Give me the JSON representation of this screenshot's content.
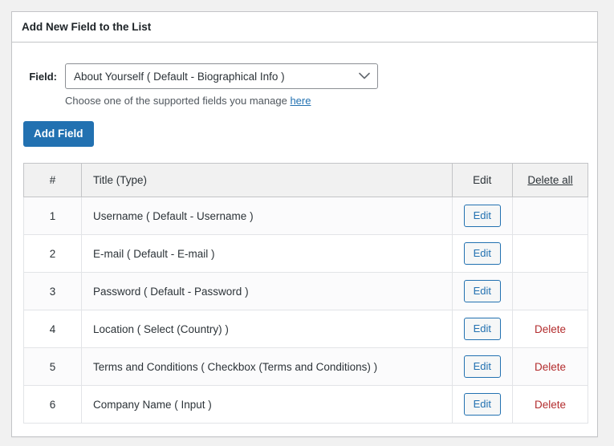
{
  "panel": {
    "title": "Add New Field to the List"
  },
  "form": {
    "field_label": "Field:",
    "selected_option": "About Yourself ( Default - Biographical Info )",
    "options": [
      "About Yourself ( Default - Biographical Info )"
    ],
    "chevron_icon": "chevron-down-icon",
    "helper_text": "Choose one of the supported fields you manage",
    "helper_link": "here",
    "add_button": "Add Field"
  },
  "table": {
    "headers": {
      "num": "#",
      "title": "Title (Type)",
      "edit": "Edit",
      "delete_all": "Delete all"
    },
    "rows": [
      {
        "num": "1",
        "title": "Username ( Default - Username )",
        "edit": "Edit",
        "delete": ""
      },
      {
        "num": "2",
        "title": "E-mail ( Default - E-mail )",
        "edit": "Edit",
        "delete": ""
      },
      {
        "num": "3",
        "title": "Password ( Default - Password )",
        "edit": "Edit",
        "delete": ""
      },
      {
        "num": "4",
        "title": "Location ( Select (Country) )",
        "edit": "Edit",
        "delete": "Delete"
      },
      {
        "num": "5",
        "title": "Terms and Conditions ( Checkbox (Terms and Conditions) )",
        "edit": "Edit",
        "delete": "Delete"
      },
      {
        "num": "6",
        "title": "Company Name ( Input )",
        "edit": "Edit",
        "delete": "Delete"
      }
    ]
  },
  "colors": {
    "primary": "#2271b1",
    "delete": "#b32d2e",
    "page_bg": "#f1f1f1",
    "border": "#c3c4c7"
  }
}
